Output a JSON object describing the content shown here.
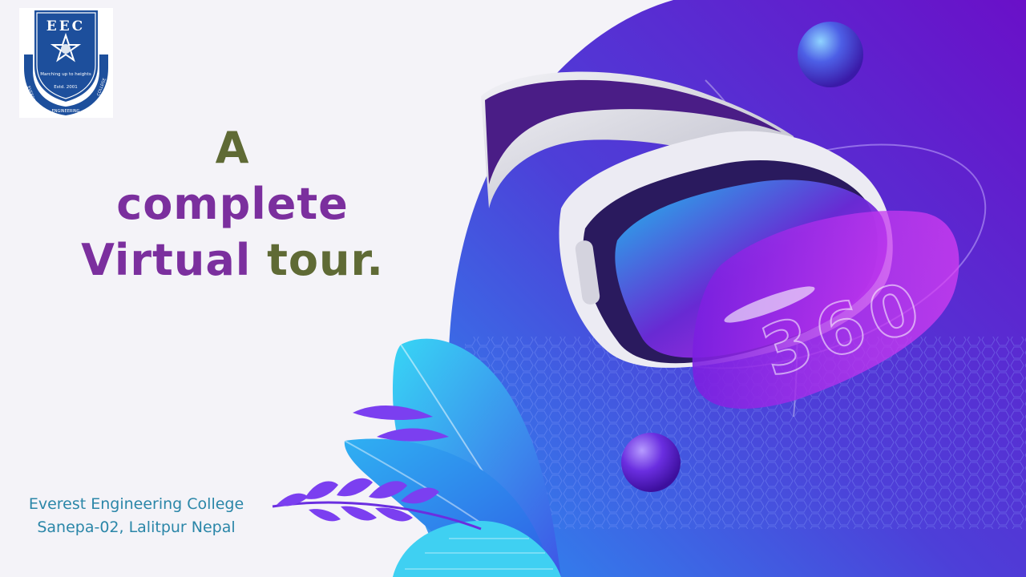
{
  "logo": {
    "initials": "EEC",
    "motto": "Marching up to heights",
    "established": "Estd. 2001",
    "ring_left": "EVEREST",
    "ring_bottom": "ENGINEERING",
    "ring_right": "COLLEGE"
  },
  "headline": {
    "line1": "A",
    "line2": "complete",
    "line3_word1": "Virtual",
    "line3_word2": "tour."
  },
  "footer": {
    "college_name": "Everest Engineering College",
    "address": "Sanepa-02, Lalitpur Nepal"
  },
  "illustration": {
    "badge_text": "360"
  },
  "colors": {
    "olive": "#5f6a35",
    "purple": "#7b2f9e",
    "footer_text": "#2a86a8",
    "logo_blue": "#1d4f9c"
  }
}
